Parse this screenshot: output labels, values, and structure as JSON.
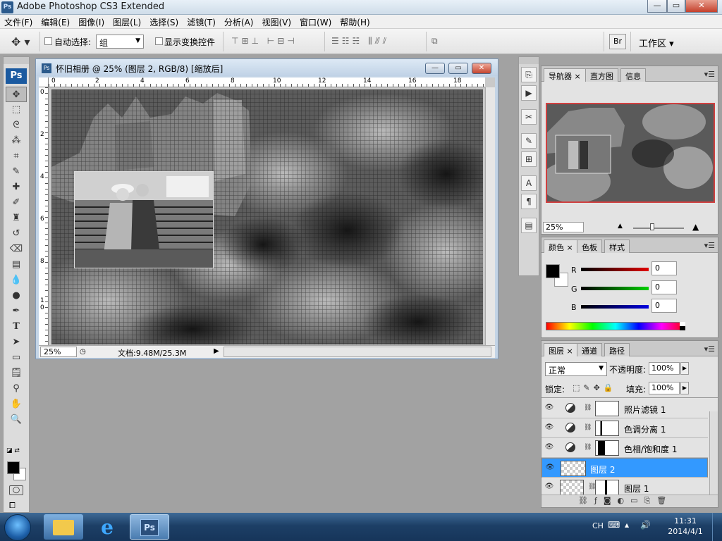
{
  "app": {
    "title": "Adobe Photoshop CS3 Extended",
    "icon_text": "Ps"
  },
  "window_controls": {
    "minimize": "—",
    "restore": "▭",
    "close": "✕"
  },
  "menu": [
    "文件(F)",
    "编辑(E)",
    "图像(I)",
    "图层(L)",
    "选择(S)",
    "滤镜(T)",
    "分析(A)",
    "视图(V)",
    "窗口(W)",
    "帮助(H)"
  ],
  "options": {
    "auto_select_label": "自动选择:",
    "auto_select_value": "组",
    "show_transform_label": "显示变换控件",
    "workspace_label": "工作区 ▾"
  },
  "toolbox": {
    "logo": "Ps"
  },
  "document": {
    "title": "怀旧相册 @ 25% (图层 2, RGB/8) [缩放后]",
    "ruler_h": [
      "0",
      "2",
      "4",
      "6",
      "8",
      "10",
      "12",
      "14",
      "16",
      "18"
    ],
    "ruler_v": [
      "0",
      "2",
      "4",
      "6",
      "8",
      "1 0"
    ],
    "zoom": "25%",
    "doc_size": "文档:9.48M/25.3M"
  },
  "navigator": {
    "tabs": [
      "导航器",
      "直方图",
      "信息"
    ],
    "zoom": "25%"
  },
  "color": {
    "tabs": [
      "颜色",
      "色板",
      "样式"
    ],
    "channels": [
      {
        "label": "R",
        "value": "0",
        "color": "#cc0000"
      },
      {
        "label": "G",
        "value": "0",
        "color": "#00aa00"
      },
      {
        "label": "B",
        "value": "0",
        "color": "#0000cc"
      }
    ]
  },
  "layers": {
    "tabs": [
      "图层",
      "通道",
      "路径"
    ],
    "blend_mode": "正常",
    "opacity_label": "不透明度:",
    "opacity": "100%",
    "lock_label": "锁定:",
    "fill_label": "填充:",
    "fill": "100%",
    "items": [
      {
        "name": "照片滤镜 1",
        "type": "adjustment"
      },
      {
        "name": "色调分离 1",
        "type": "adjustment"
      },
      {
        "name": "色相/饱和度 1",
        "type": "adjustment"
      },
      {
        "name": "图层 2",
        "type": "pixel",
        "selected": true
      },
      {
        "name": "图层 1",
        "type": "pixel"
      }
    ]
  },
  "taskbar": {
    "lang": "CH",
    "time": "11:31",
    "date": "2014/4/1",
    "ps_label": "Ps"
  }
}
